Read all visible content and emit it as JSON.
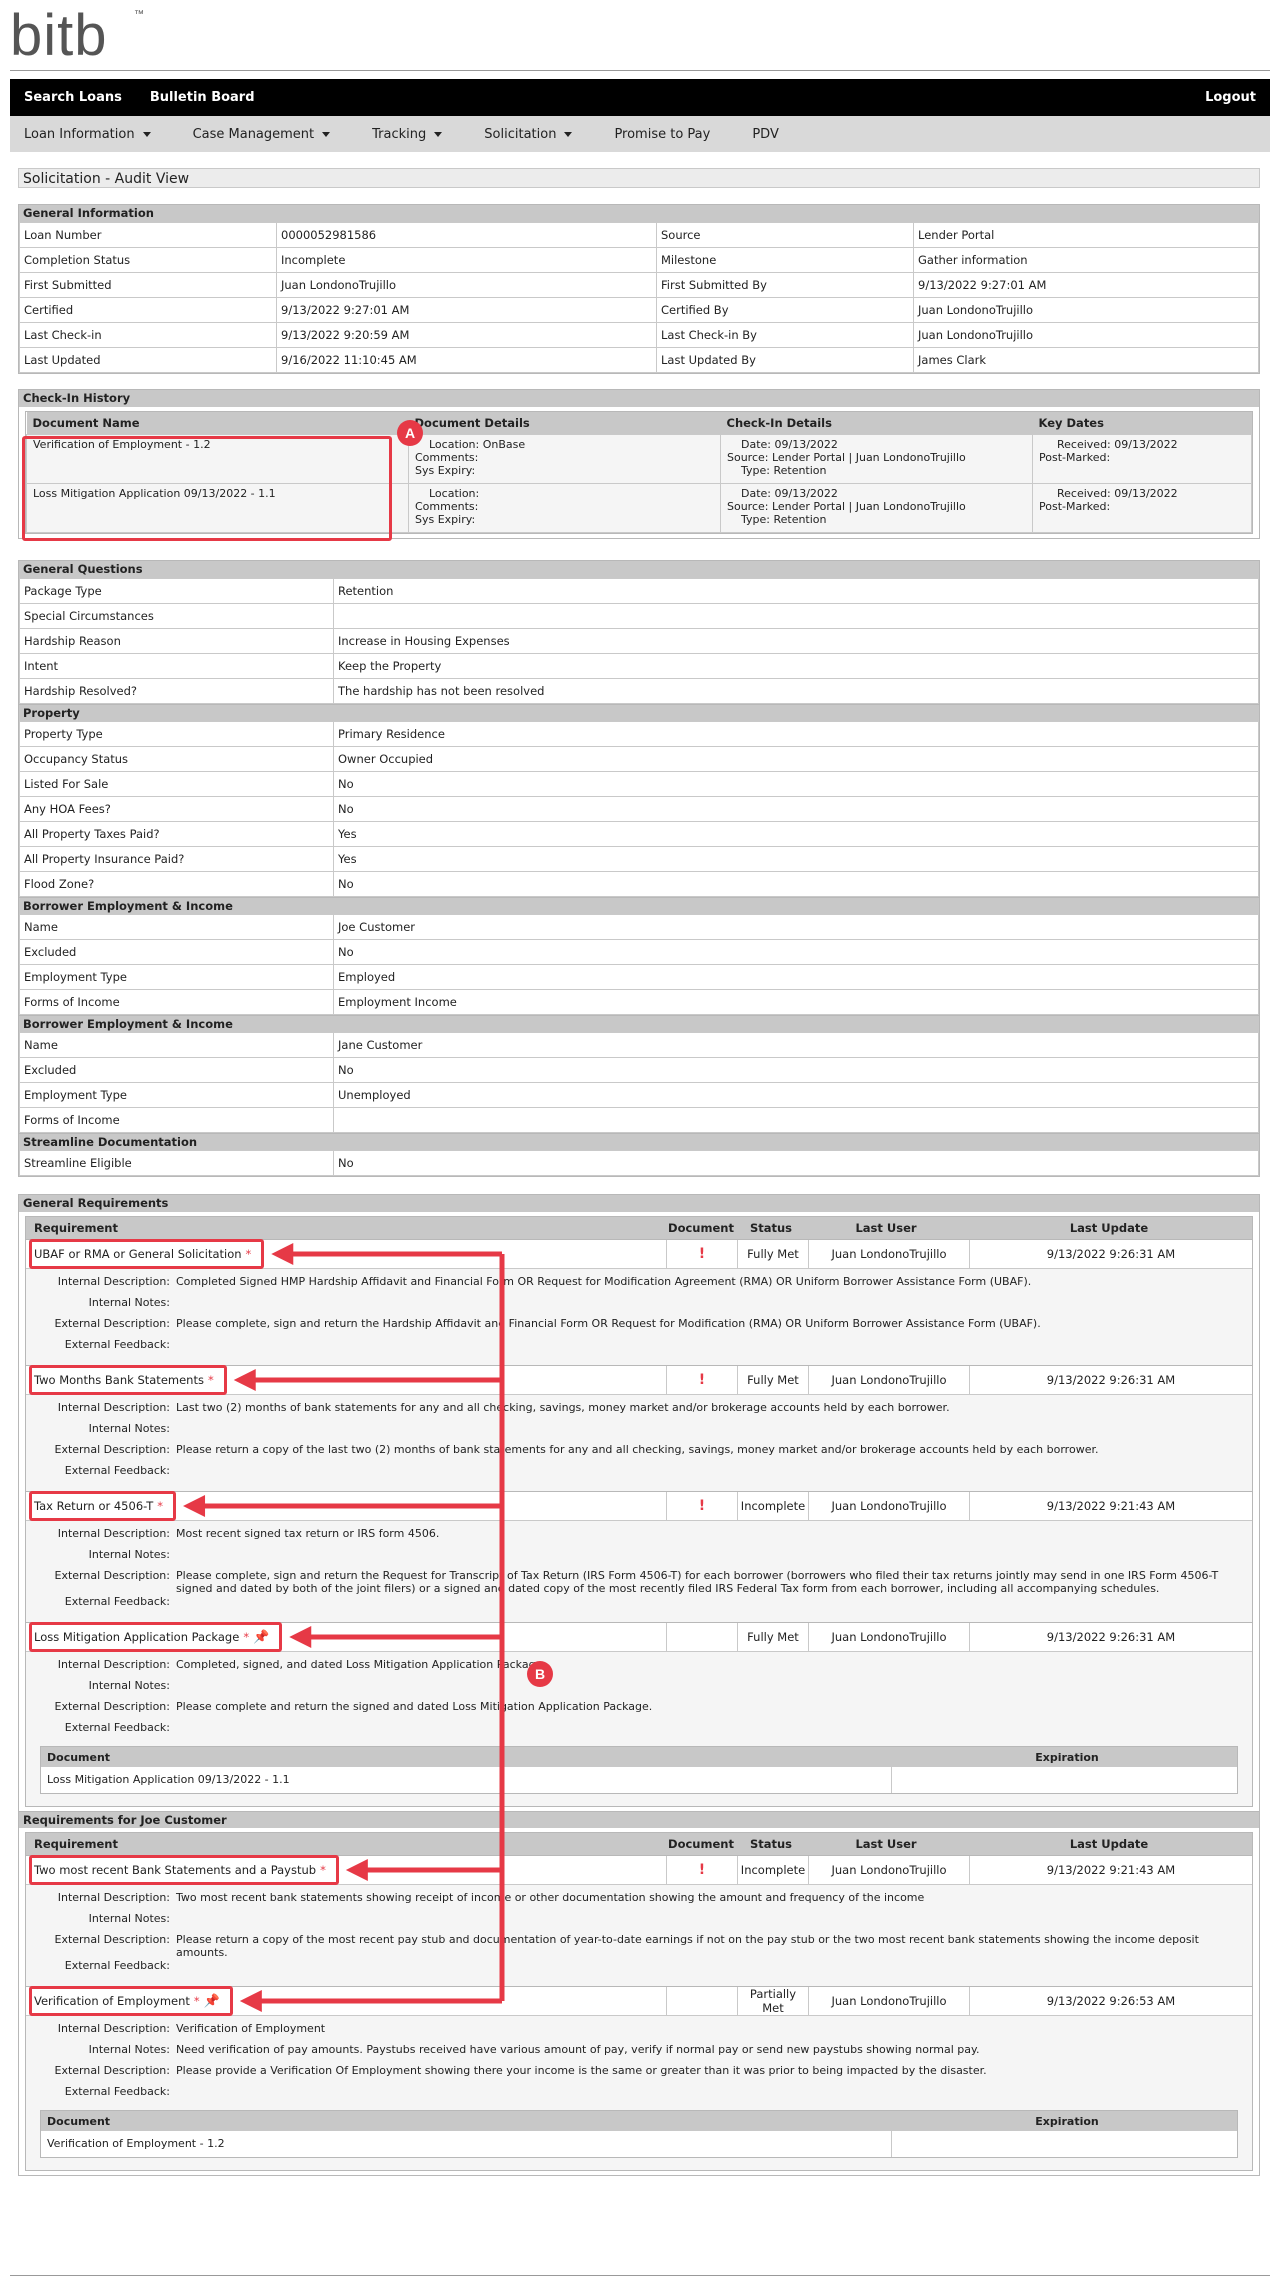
{
  "brand": {
    "logo_text": "bitb",
    "trademark": "™"
  },
  "topbar": {
    "search_loans": "Search Loans",
    "bulletin_board": "Bulletin Board",
    "logout": "Logout"
  },
  "menu": {
    "loan_information": "Loan Information",
    "case_management": "Case Management",
    "tracking": "Tracking",
    "solicitation": "Solicitation",
    "promise_to_pay": "Promise to Pay",
    "pdv": "PDV"
  },
  "page_title": "Solicitation - Audit View",
  "general_info": {
    "header": "General Information",
    "rows": [
      [
        "Loan Number",
        "0000052981586",
        "Source",
        "Lender Portal"
      ],
      [
        "Completion Status",
        "Incomplete",
        "Milestone",
        "Gather information"
      ],
      [
        "First Submitted",
        "Juan LondonoTrujillo",
        "First Submitted By",
        "9/13/2022 9:27:01 AM"
      ],
      [
        "Certified",
        "9/13/2022 9:27:01 AM",
        "Certified By",
        "Juan LondonoTrujillo"
      ],
      [
        "Last Check-in",
        "9/13/2022 9:20:59 AM",
        "Last Check-in By",
        "Juan LondonoTrujillo"
      ],
      [
        "Last Updated",
        "9/16/2022 11:10:45 AM",
        "Last Updated By",
        "James Clark"
      ]
    ]
  },
  "checkin_history": {
    "header": "Check-In History",
    "columns": [
      "Document Name",
      "Document Details",
      "Check-In Details",
      "Key Dates"
    ],
    "rows": [
      {
        "name": "Verification of Employment - 1.2",
        "location": "Location: OnBase",
        "comments": "Comments:",
        "expiry": "Sys Expiry:",
        "date": "Date: 09/13/2022",
        "source": "Source: Lender Portal | Juan LondonoTrujillo",
        "type": "Type: Retention",
        "received": "Received: 09/13/2022",
        "postmarked": "Post-Marked:"
      },
      {
        "name": "Loss Mitigation Application 09/13/2022 - 1.1",
        "location": "Location:",
        "comments": "Comments:",
        "expiry": "Sys Expiry:",
        "date": "Date: 09/13/2022",
        "source": "Source: Lender Portal | Juan LondonoTrujillo",
        "type": "Type: Retention",
        "received": "Received: 09/13/2022",
        "postmarked": "Post-Marked:"
      }
    ]
  },
  "general_questions": {
    "header": "General Questions",
    "rows": [
      [
        "Package Type",
        "Retention"
      ],
      [
        "Special Circumstances",
        ""
      ],
      [
        "Hardship Reason",
        "Increase in Housing Expenses"
      ],
      [
        "Intent",
        "Keep the Property"
      ],
      [
        "Hardship Resolved?",
        "The hardship has not been resolved"
      ]
    ],
    "property_header": "Property",
    "property_rows": [
      [
        "Property Type",
        "Primary Residence"
      ],
      [
        "Occupancy Status",
        "Owner Occupied"
      ],
      [
        "Listed For Sale",
        "No"
      ],
      [
        "Any HOA Fees?",
        "No"
      ],
      [
        "All Property Taxes Paid?",
        "Yes"
      ],
      [
        "All Property Insurance Paid?",
        "Yes"
      ],
      [
        "Flood Zone?",
        "No"
      ]
    ],
    "borrower1_header": "Borrower Employment & Income",
    "borrower1_rows": [
      [
        "Name",
        "Joe Customer"
      ],
      [
        "Excluded",
        "No"
      ],
      [
        "Employment Type",
        "Employed"
      ],
      [
        "Forms of Income",
        "Employment Income"
      ]
    ],
    "borrower2_header": "Borrower Employment & Income",
    "borrower2_rows": [
      [
        "Name",
        "Jane Customer"
      ],
      [
        "Excluded",
        "No"
      ],
      [
        "Employment Type",
        "Unemployed"
      ],
      [
        "Forms of Income",
        ""
      ]
    ],
    "streamline_header": "Streamline Documentation",
    "streamline_rows": [
      [
        "Streamline Eligible",
        "No"
      ]
    ]
  },
  "general_requirements": {
    "header": "General Requirements",
    "columns": {
      "requirement": "Requirement",
      "document": "Document",
      "status": "Status",
      "last_user": "Last User",
      "last_update": "Last Update"
    },
    "labels": {
      "internal_description": "Internal Description:",
      "internal_notes": "Internal Notes:",
      "external_description": "External Description:",
      "external_feedback": "External Feedback:"
    },
    "items": [
      {
        "name": "UBAF or RMA or General Solicitation",
        "marker": "*",
        "status": "Fully Met",
        "user": "Juan LondonoTrujillo",
        "update": "9/13/2022 9:26:31 AM",
        "internal": "Completed Signed HMP Hardship Affidavit and Financial Form OR Request for Modification Agreement (RMA) OR Uniform Borrower Assistance Form (UBAF).",
        "notes": "",
        "external": "Please complete, sign and return the Hardship Affidavit and Financial Form OR Request for Modification (RMA) OR Uniform Borrower Assistance Form (UBAF).",
        "feedback": ""
      },
      {
        "name": "Two Months Bank Statements",
        "marker": "*",
        "status": "Fully Met",
        "user": "Juan LondonoTrujillo",
        "update": "9/13/2022 9:26:31 AM",
        "internal": "Last two (2) months of bank statements for any and all checking, savings, money market and/or brokerage accounts held by each borrower.",
        "notes": "",
        "external": "Please return a copy of the last two (2) months of bank statements for any and all checking, savings, money market and/or brokerage accounts held by each borrower.",
        "feedback": ""
      },
      {
        "name": "Tax Return or 4506-T",
        "marker": "*",
        "status": "Incomplete",
        "user": "Juan LondonoTrujillo",
        "update": "9/13/2022 9:21:43 AM",
        "internal": "Most recent signed tax return or IRS form 4506.",
        "notes": "",
        "external": "Please complete, sign and return the Request for Transcript of Tax Return (IRS Form 4506-T) for each borrower (borrowers who filed their tax returns jointly may send in one IRS Form 4506-T signed and dated by both of the joint filers) or a signed and dated copy of the most recently filed IRS Federal Tax form from each borrower, including all accompanying schedules.",
        "feedback": ""
      },
      {
        "name": "Loss Mitigation Application Package",
        "marker": "*",
        "status": "Fully Met",
        "user": "Juan LondonoTrujillo",
        "update": "9/13/2022 9:26:31 AM",
        "internal": "Completed, signed, and dated Loss Mitigation Application Package",
        "notes": "",
        "external": "Please complete and return the signed and dated Loss Mitigation Application Package.",
        "feedback": "",
        "doc_header": "Document",
        "exp_header": "Expiration",
        "doc_name": "Loss Mitigation Application 09/13/2022 - 1.1"
      }
    ]
  },
  "joe_requirements": {
    "header": "Requirements for Joe Customer",
    "items": [
      {
        "name": "Two most recent Bank Statements and a Paystub",
        "marker": "*",
        "status": "Incomplete",
        "user": "Juan LondonoTrujillo",
        "update": "9/13/2022 9:21:43 AM",
        "internal": "Two most recent bank statements showing receipt of income or other documentation showing the amount and frequency of the income",
        "notes": "",
        "external": "Please return a copy of the most recent pay stub and documentation of year-to-date earnings if not on the pay stub or the two most recent bank statements showing the income deposit amounts.",
        "feedback": ""
      },
      {
        "name": "Verification of Employment",
        "marker": "*",
        "status": "Partially Met",
        "user": "Juan LondonoTrujillo",
        "update": "9/13/2022 9:26:53 AM",
        "internal": "Verification of Employment",
        "notes": "Need verification of pay amounts. Paystubs received have various amount of pay, verify if normal pay or send new paystubs showing normal pay.",
        "external": "Please provide a Verification Of Employment showing there your income is the same or greater than it was prior to being impacted by the disaster.",
        "feedback": "",
        "doc_header": "Document",
        "exp_header": "Expiration",
        "doc_name": "Verification of Employment - 1.2"
      }
    ]
  },
  "annotations": {
    "a": "A",
    "b": "B",
    "accent_color": "#e63946"
  },
  "icons": {
    "document_missing": "exclamation-icon",
    "pinned": "pin-icon"
  }
}
